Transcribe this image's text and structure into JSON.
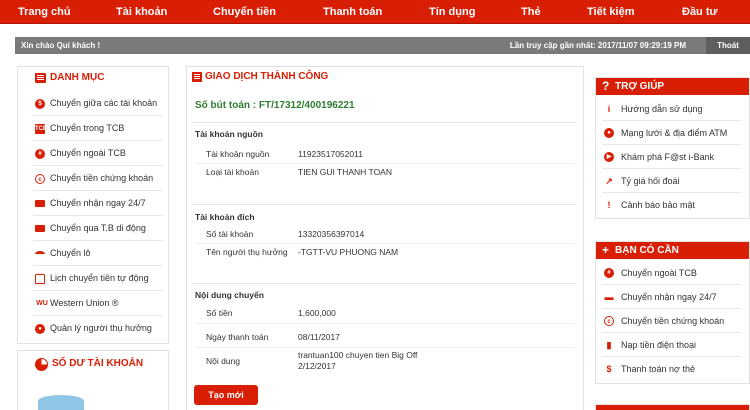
{
  "nav": {
    "items": [
      "Trang chủ",
      "Tài khoản",
      "Chuyển tiền",
      "Thanh toán",
      "Tín dụng",
      "Thẻ",
      "Tiết kiệm",
      "Đầu tư"
    ]
  },
  "welcome": {
    "greeting": "Xin chào Quí khách !",
    "last_access": "Lần truy cập gần nhất: 2017/11/07 09:29:19 PM",
    "logout": "Thoát"
  },
  "menu": {
    "title": "DANH MỤC",
    "items": [
      {
        "label": "Chuyển giữa các tài khoản",
        "icon": "dollar-icon"
      },
      {
        "label": "Chuyển trong TCB",
        "icon": "tcb-icon"
      },
      {
        "label": "Chuyển ngoài TCB",
        "icon": "hash-icon"
      },
      {
        "label": "Chuyển tiền chứng khoán",
        "icon": "stock-icon"
      },
      {
        "label": "Chuyển nhận ngay 24/7",
        "icon": "fast-transfer-icon"
      },
      {
        "label": "Chuyển qua T.B di động",
        "icon": "mobile-icon"
      },
      {
        "label": "Chuyển lô",
        "icon": "batch-icon"
      },
      {
        "label": "Lịch chuyển tiền tự động",
        "icon": "schedule-icon"
      },
      {
        "label": "Western Union ®",
        "icon": "western-union-icon"
      },
      {
        "label": "Quản lý người thụ hưởng",
        "icon": "beneficiary-icon"
      }
    ]
  },
  "balance": {
    "title": "SỐ DƯ TÀI KHOẢN"
  },
  "main": {
    "title": "GIAO DỊCH THÀNH CÔNG",
    "reference": "Số bút toán : FT/17312/400196221",
    "source": {
      "heading": "Tài khoản nguồn",
      "account_label": "Tài khoản nguồn",
      "account_value": "11923517052011",
      "type_label": "Loại tài khoản",
      "type_value": "TIEN GUI THANH TOAN"
    },
    "destination": {
      "heading": "Tài khoản đích",
      "number_label": "Số tài khoản",
      "number_value": "13320356397014",
      "name_label": "Tên người thụ hưởng",
      "name_value": "-TGTT-VU PHUONG NAM"
    },
    "content": {
      "heading": "Nội dung chuyển",
      "amount_label": "Số tiền",
      "amount_value": "1,600,000",
      "date_label": "Ngày thanh toán",
      "date_value": "08/11/2017",
      "desc_label": "Nội dung",
      "desc_line1": "trantuan100 chuyen tien Big Off",
      "desc_line2": "2/12/2017"
    },
    "new_button": "Tạo mới"
  },
  "help": {
    "title": "TRỢ GIÚP",
    "items": [
      {
        "label": "Hướng dẫn sử dụng",
        "icon": "info-icon"
      },
      {
        "label": "Mạng lưới & địa điểm ATM",
        "icon": "location-pin-icon"
      },
      {
        "label": "Khám phá F@st i-Bank",
        "icon": "play-icon"
      },
      {
        "label": "Tỷ giá hối đoái",
        "icon": "trend-icon"
      },
      {
        "label": "Cảnh báo bảo mật",
        "icon": "alert-icon"
      }
    ]
  },
  "need": {
    "title": "BẠN CÓ CẦN",
    "items": [
      {
        "label": "Chuyển ngoài TCB",
        "icon": "hash-icon"
      },
      {
        "label": "Chuyển nhận ngay 24/7",
        "icon": "fast-transfer-icon"
      },
      {
        "label": "Chuyển tiền chứng khoán",
        "icon": "stock-icon"
      },
      {
        "label": "Nạp tiền điện thoại",
        "icon": "phone-icon"
      },
      {
        "label": "Thanh toán nợ thẻ",
        "icon": "card-icon"
      }
    ]
  },
  "colors": {
    "brand": "#d81e05",
    "success": "#2e7d32",
    "bar": "#7a7a7a"
  }
}
